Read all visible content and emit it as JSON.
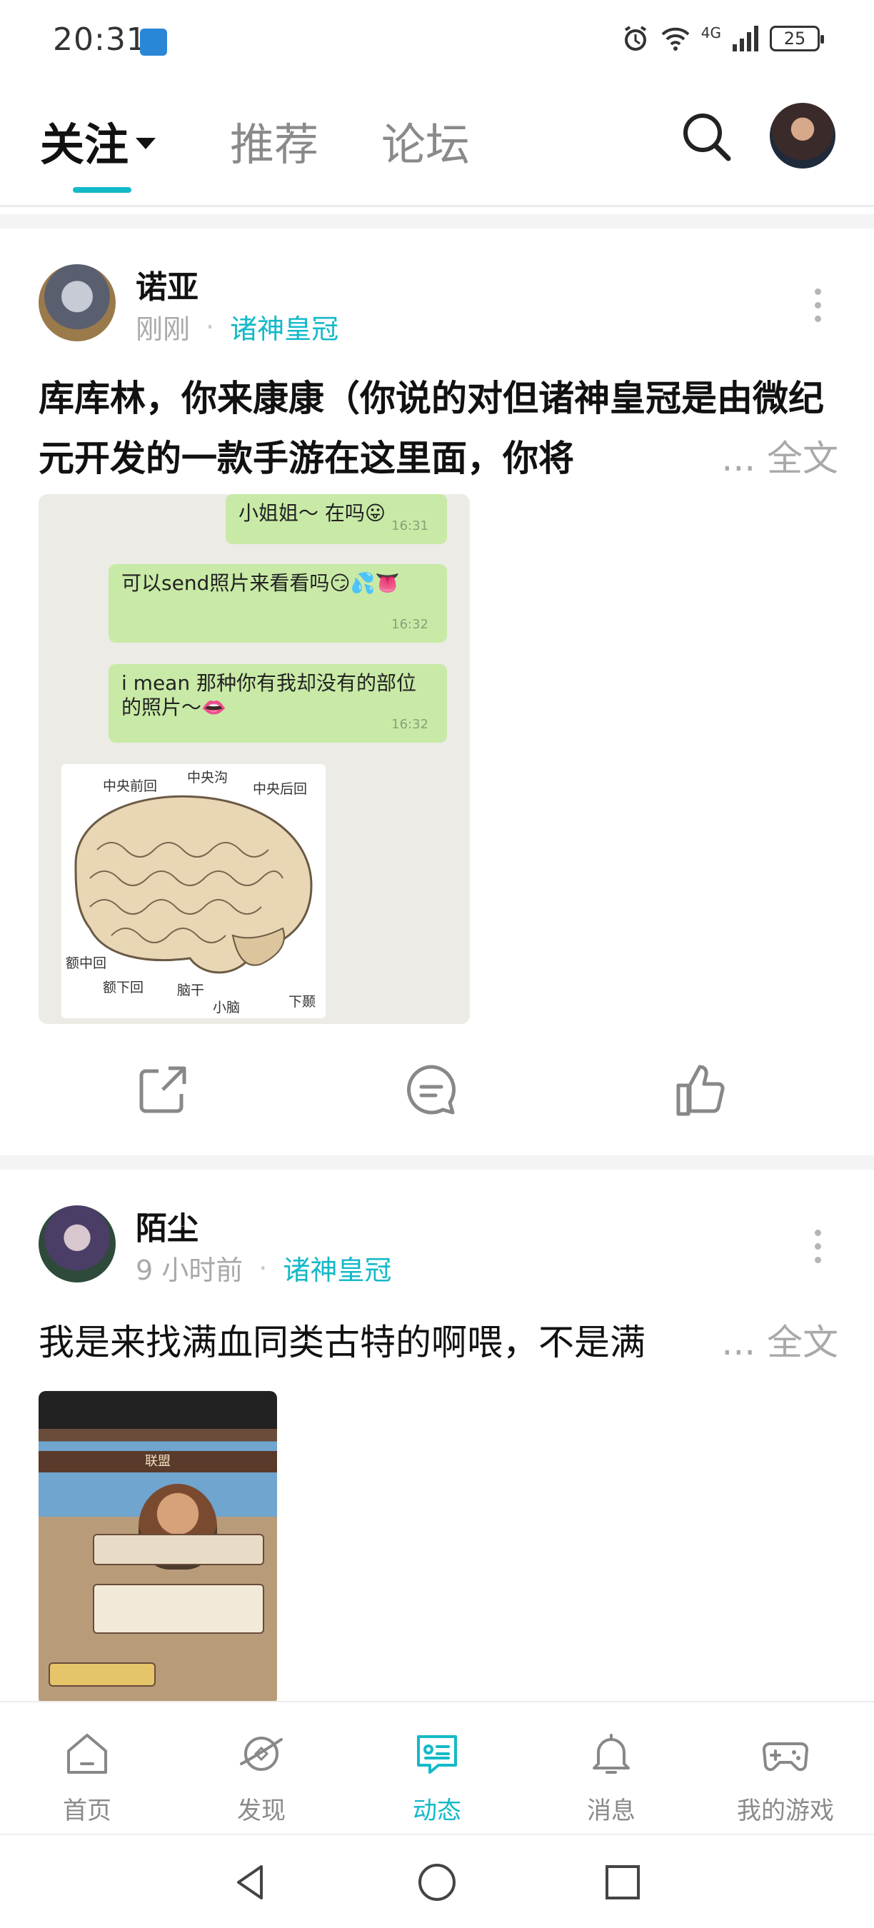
{
  "status_bar": {
    "time": "20:31",
    "network": "4G",
    "battery": "25"
  },
  "top_nav": {
    "tabs": [
      {
        "label": "关注",
        "active": true
      },
      {
        "label": "推荐",
        "active": false
      },
      {
        "label": "论坛",
        "active": false
      }
    ],
    "search_icon": "search-icon",
    "accent_color": "#14b9c8"
  },
  "posts": [
    {
      "author": "诺亚",
      "time": "刚刚",
      "game": "诸神皇冠",
      "text": "库库林，你来康康（你说的对但诸神皇冠是由微纪元开发的一款手游在这里面，你将",
      "more_label": "... 全文",
      "image": {
        "messages": [
          {
            "text": "小姐姐～ 在吗😛",
            "time": "16:31"
          },
          {
            "text": "可以send照片来看看吗😏💦👅",
            "time": "16:32"
          },
          {
            "text": "i mean 那种你有我却没有的部位的照片～👄",
            "time": "16:32"
          }
        ],
        "brain_labels": [
          "中央前回",
          "中央沟",
          "中央后回",
          "额中回",
          "额下回",
          "脑干",
          "小脑",
          "下颞"
        ]
      }
    },
    {
      "author": "陌尘",
      "time": "9 小时前",
      "game": "诸神皇冠",
      "text": "我是来找满血同类古特的啊喂，不是满",
      "more_label": "... 全文",
      "image": {
        "title": "联盟"
      }
    }
  ],
  "bottom_nav": [
    {
      "label": "首页",
      "icon": "home-icon",
      "active": false
    },
    {
      "label": "发现",
      "icon": "discover-icon",
      "active": false
    },
    {
      "label": "动态",
      "icon": "feed-icon",
      "active": true
    },
    {
      "label": "消息",
      "icon": "bell-icon",
      "active": false
    },
    {
      "label": "我的游戏",
      "icon": "gamepad-icon",
      "active": false
    }
  ]
}
